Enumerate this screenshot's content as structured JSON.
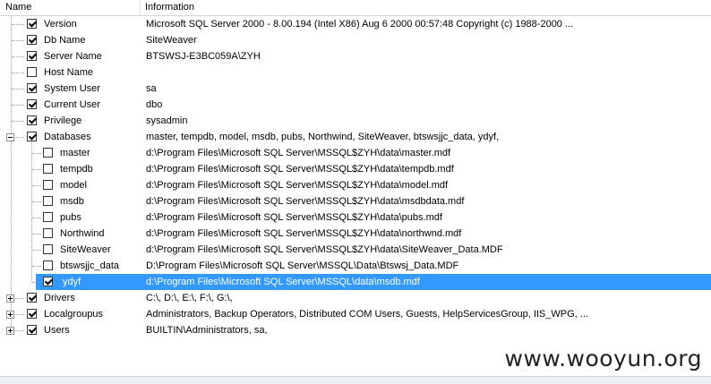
{
  "header": {
    "name": "Name",
    "information": "Information"
  },
  "rows": [
    {
      "name": "Version",
      "info": "Microsoft SQL Server  2000 - 8.00.194 (Intel X86) Aug  6 2000 00:57:48 Copyright (c) 1988-2000 ...",
      "level": 0,
      "checked": true
    },
    {
      "name": "Db Name",
      "info": "SiteWeaver",
      "level": 0,
      "checked": true
    },
    {
      "name": "Server Name",
      "info": "BTSWSJ-E3BC059A\\ZYH",
      "level": 0,
      "checked": true
    },
    {
      "name": "Host Name",
      "info": "",
      "level": 0,
      "checked": false
    },
    {
      "name": "System User",
      "info": "sa",
      "level": 0,
      "checked": true
    },
    {
      "name": "Current User",
      "info": "dbo",
      "level": 0,
      "checked": true
    },
    {
      "name": "Privilege",
      "info": "sysadmin",
      "level": 0,
      "checked": true
    },
    {
      "name": "Databases",
      "info": "master, tempdb, model, msdb, pubs, Northwind, SiteWeaver, btswsjjc_data, ydyf,",
      "level": 0,
      "checked": true,
      "expander": "minus"
    },
    {
      "name": "master",
      "info": "d:\\Program Files\\Microsoft SQL Server\\MSSQL$ZYH\\data\\master.mdf",
      "level": 1,
      "checked": false
    },
    {
      "name": "tempdb",
      "info": "d:\\Program Files\\Microsoft SQL Server\\MSSQL$ZYH\\data\\tempdb.mdf",
      "level": 1,
      "checked": false
    },
    {
      "name": "model",
      "info": "d:\\Program Files\\Microsoft SQL Server\\MSSQL$ZYH\\data\\model.mdf",
      "level": 1,
      "checked": false
    },
    {
      "name": "msdb",
      "info": "d:\\Program Files\\Microsoft SQL Server\\MSSQL$ZYH\\data\\msdbdata.mdf",
      "level": 1,
      "checked": false
    },
    {
      "name": "pubs",
      "info": "d:\\Program Files\\Microsoft SQL Server\\MSSQL$ZYH\\data\\pubs.mdf",
      "level": 1,
      "checked": false
    },
    {
      "name": "Northwind",
      "info": "d:\\Program Files\\Microsoft SQL Server\\MSSQL$ZYH\\data\\northwnd.mdf",
      "level": 1,
      "checked": false
    },
    {
      "name": "SiteWeaver",
      "info": "d:\\Program Files\\Microsoft SQL Server\\MSSQL$ZYH\\data\\SiteWeaver_Data.MDF",
      "level": 1,
      "checked": false
    },
    {
      "name": "btswsjjc_data",
      "info": "D:\\Program Files\\Microsoft SQL Server\\MSSQL\\Data\\Btswsj_Data.MDF",
      "level": 1,
      "checked": false
    },
    {
      "name": "ydyf",
      "info": "d:\\Program Files\\Microsoft SQL Server\\MSSQL\\data\\msdb.mdf",
      "level": 1,
      "checked": true,
      "selected": true
    },
    {
      "name": "Drivers",
      "info": "C:\\, D:\\, E:\\, F:\\, G:\\,",
      "level": 0,
      "checked": true,
      "expander": "plus"
    },
    {
      "name": "Localgroupus",
      "info": "Administrators, Backup Operators, Distributed COM Users, Guests, HelpServicesGroup, IIS_WPG, ...",
      "level": 0,
      "checked": true,
      "expander": "plus"
    },
    {
      "name": "Users",
      "info": "BUILTIN\\Administrators, sa,",
      "level": 0,
      "checked": true,
      "expander": "plus"
    }
  ],
  "watermark": "www.wooyun.org",
  "colors": {
    "selection": "#3399ff"
  }
}
